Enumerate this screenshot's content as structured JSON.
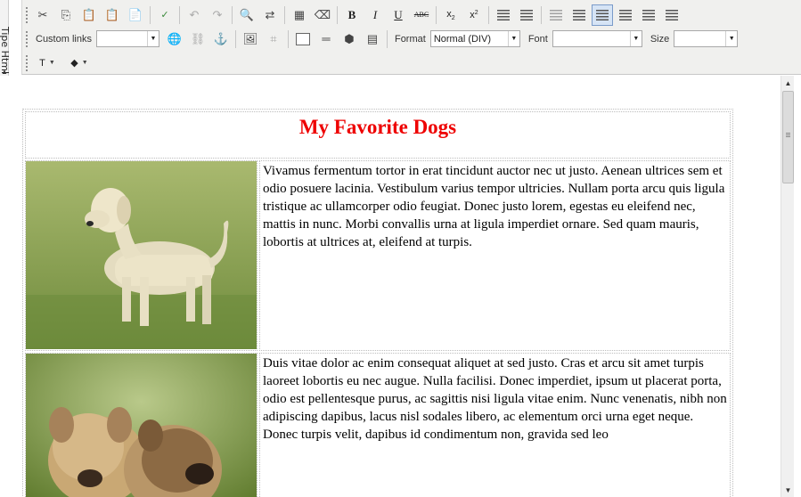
{
  "side_panel": {
    "label": "Tipe Html"
  },
  "toolbar": {
    "custom_links_label": "Custom links",
    "custom_links_value": "",
    "format_label": "Format",
    "format_value": "Normal (DIV)",
    "font_label": "Font",
    "font_value": "",
    "size_label": "Size",
    "size_value": "",
    "buttons_row1": [
      "cut",
      "copy",
      "paste",
      "paste-text",
      "paste-word",
      "spellcheck",
      "undo",
      "redo",
      "find",
      "replace",
      "select-all",
      "clear-format",
      "bold",
      "italic",
      "underline",
      "strikethrough",
      "subscript",
      "superscript",
      "numbered-list",
      "bulleted-list",
      "outdent",
      "indent",
      "align-left",
      "align-center",
      "align-right",
      "justify"
    ],
    "active_button": "align-left"
  },
  "document": {
    "title": "My Favorite Dogs",
    "title_color": "#ee0000",
    "rows": [
      {
        "image": "labrador-dog-photo",
        "text": "Vivamus fermentum tortor in erat tincidunt auctor nec ut justo. Aenean ultrices sem et odio posuere lacinia. Vestibulum varius tempor ultricies. Nullam porta arcu quis ligula tristique ac ullamcorper odio feugiat. Donec justo lorem, egestas eu eleifend nec, mattis in nunc. Morbi convallis urna at ligula imperdiet ornare. Sed quam mauris, lobortis at ultrices at, eleifend at turpis."
      },
      {
        "image": "two-puppies-photo",
        "text": " Duis vitae dolor ac enim consequat aliquet at sed justo. Cras et arcu sit amet turpis laoreet lobortis eu nec augue. Nulla facilisi. Donec imperdiet, ipsum ut placerat porta, odio est pellentesque purus, ac sagittis nisi ligula vitae enim. Nunc venenatis, nibh non adipiscing dapibus, lacus nisl sodales libero, ac elementum orci urna eget neque. Donec turpis velit, dapibus id condimentum non, gravida sed leo"
      }
    ]
  }
}
